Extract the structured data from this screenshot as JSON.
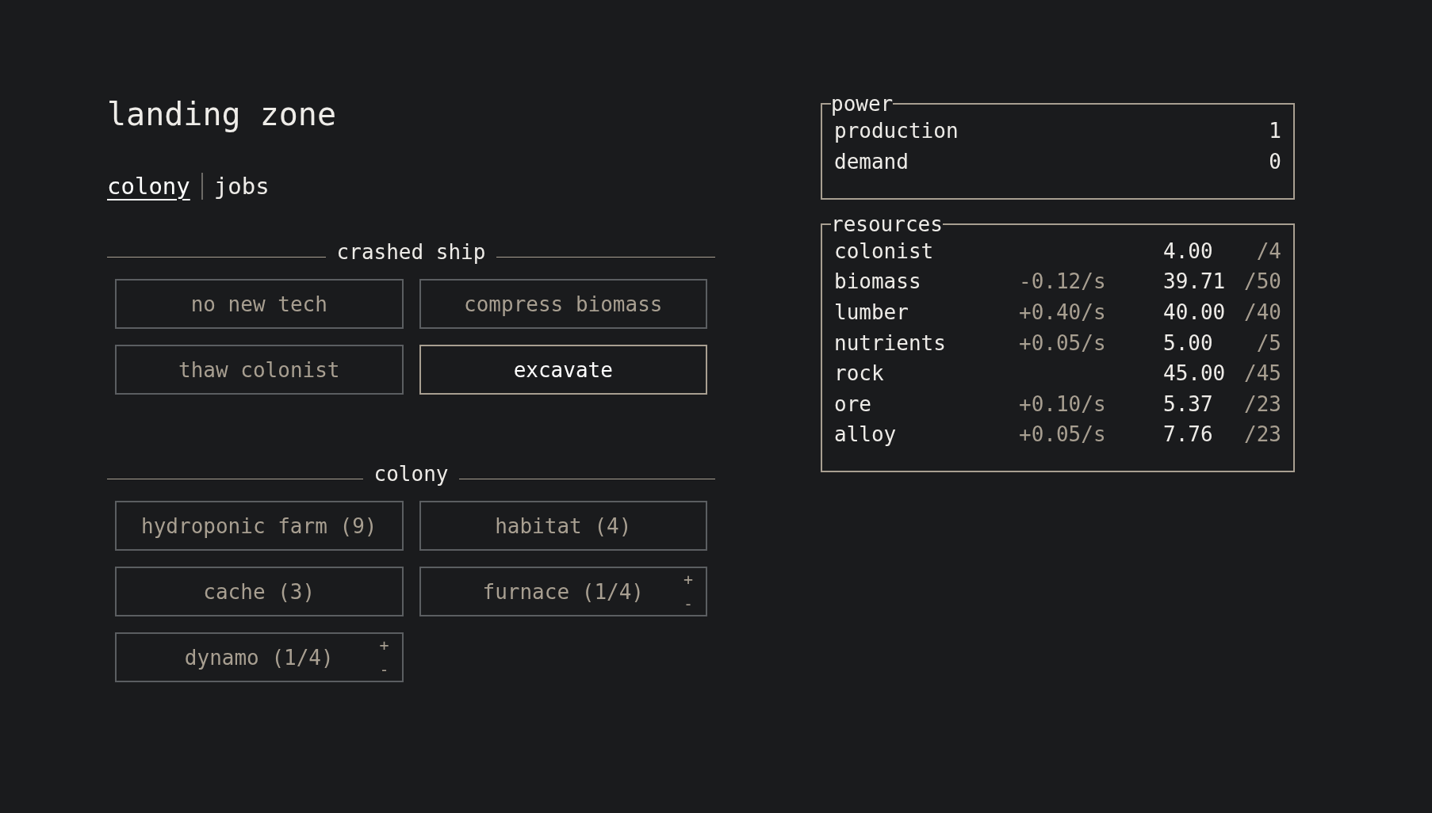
{
  "title": "landing zone",
  "tabs": [
    {
      "label": "colony",
      "selected": true
    },
    {
      "label": "jobs",
      "selected": false
    }
  ],
  "sections": [
    {
      "title": "crashed ship",
      "buttons": [
        {
          "kind": "plain",
          "label": "no new tech",
          "disabled": true
        },
        {
          "kind": "plain",
          "label": "compress biomass",
          "disabled": true
        },
        {
          "kind": "plain",
          "label": "thaw colonist",
          "disabled": true
        },
        {
          "kind": "plain",
          "label": "excavate",
          "disabled": false
        }
      ]
    },
    {
      "title": "colony",
      "buttons": [
        {
          "kind": "plain",
          "label": "hydroponic farm (9)",
          "disabled": true
        },
        {
          "kind": "plain",
          "label": "habitat (4)",
          "disabled": true
        },
        {
          "kind": "plain",
          "label": "cache (3)",
          "disabled": true
        },
        {
          "kind": "adjustable",
          "label": "furnace (1/4)",
          "disabled": true,
          "increment": "+",
          "decrement": "-"
        },
        {
          "kind": "adjustable",
          "label": "dynamo (1/4)",
          "disabled": true,
          "increment": "+",
          "decrement": "-"
        }
      ]
    }
  ],
  "power": {
    "title": "power",
    "rows": [
      {
        "label": "production",
        "value": "1"
      },
      {
        "label": "demand",
        "value": "0"
      }
    ]
  },
  "resources": {
    "title": "resources",
    "rows": [
      {
        "name": "colonist",
        "amount": "4.00",
        "max": "/4"
      },
      {
        "name": "biomass",
        "rate": "-0.12/s",
        "amount": "39.71",
        "max": "/50"
      },
      {
        "name": "lumber",
        "rate": "+0.40/s",
        "amount": "40.00",
        "max": "/40"
      },
      {
        "name": "nutrients",
        "rate": "+0.05/s",
        "amount": "5.00",
        "max": "/5"
      },
      {
        "name": "rock",
        "amount": "45.00",
        "max": "/45"
      },
      {
        "name": "ore",
        "rate": "+0.10/s",
        "amount": "5.37",
        "max": "/23"
      },
      {
        "name": "alloy",
        "rate": "+0.05/s",
        "amount": "7.76",
        "max": "/23"
      }
    ]
  }
}
